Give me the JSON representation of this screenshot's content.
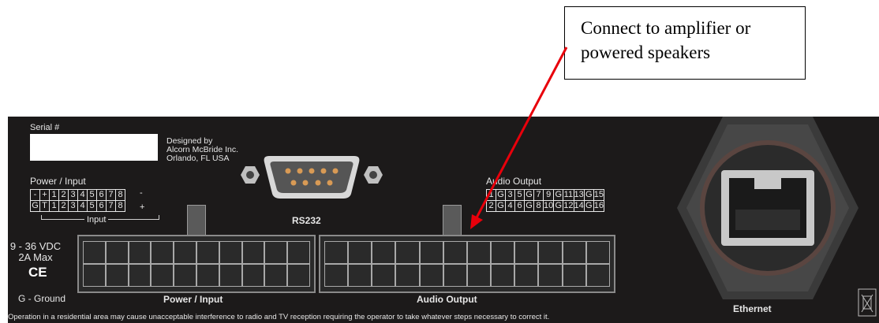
{
  "callout": {
    "line1": "Connect to amplifier or",
    "line2": "powered speakers"
  },
  "panel": {
    "serial_label": "Serial #",
    "designed": [
      "Designed by",
      "Alcorn McBride Inc.",
      "Orlando, FL USA"
    ],
    "power_input_title": "Power / Input",
    "power_rows": [
      [
        "-",
        "+",
        "1",
        "2",
        "3",
        "4",
        "5",
        "6",
        "7",
        "8"
      ],
      [
        "G",
        "T",
        "1",
        "2",
        "3",
        "4",
        "5",
        "6",
        "7",
        "8"
      ]
    ],
    "power_row_suffix": [
      "-",
      "+"
    ],
    "input_bracket_label": "Input",
    "rs232_label": "RS232",
    "audio_output_title": "Audio Output",
    "audio_rows": [
      [
        "1",
        "G",
        "3",
        "5",
        "G",
        "7",
        "9",
        "G",
        "11",
        "13",
        "G",
        "15"
      ],
      [
        "2",
        "G",
        "4",
        "6",
        "G",
        "8",
        "10",
        "G",
        "12",
        "14",
        "G",
        "16"
      ]
    ],
    "voltage": "9 - 36 VDC",
    "amps": "2A Max",
    "ce_mark": "CE",
    "ground": "G - Ground",
    "power_input_conn_label": "Power / Input",
    "audio_output_conn_label": "Audio Output",
    "ethernet_label": "Ethernet",
    "footer": "Operation in a residential area may cause unacceptable interference to radio and TV reception requiring the operator to take whatever steps necessary to correct it."
  },
  "colors": {
    "panel": "#1c1a1a",
    "arrow": "#e8000b",
    "text": "#e6e6e6"
  }
}
